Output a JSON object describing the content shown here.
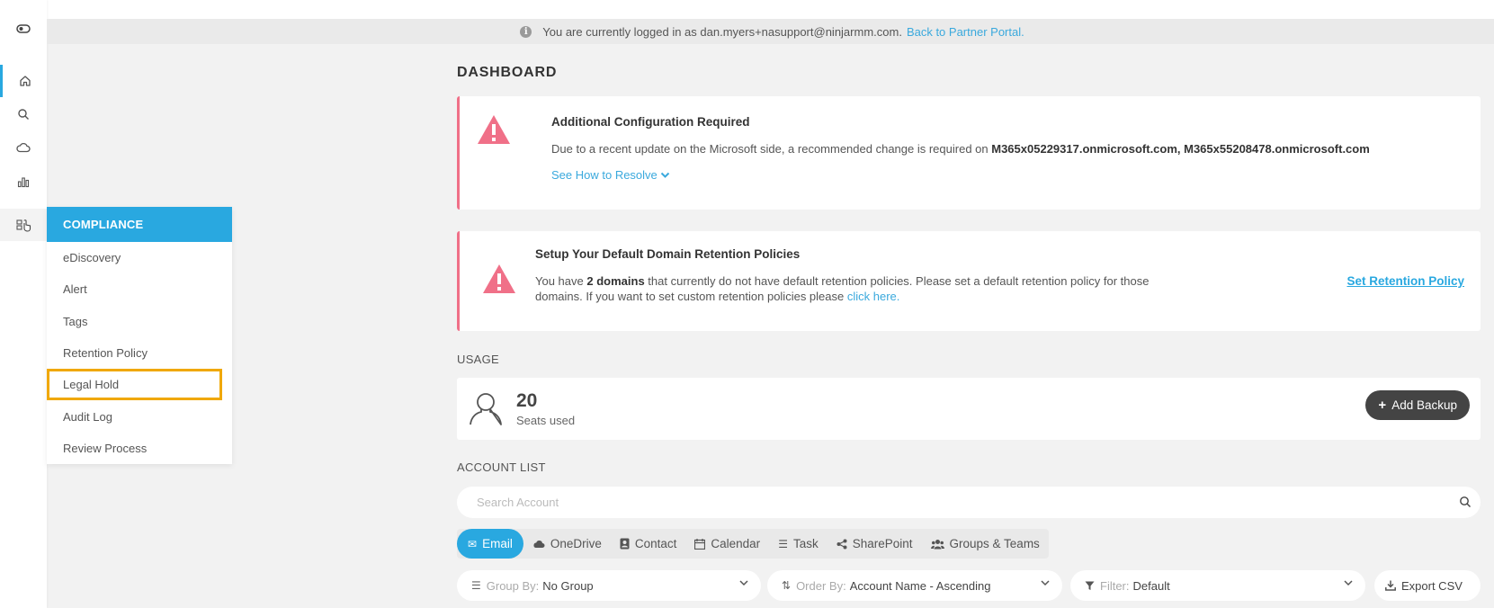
{
  "login_bar": {
    "message": "You are currently logged in as dan.myers+nasupport@ninjarmm.com.",
    "back_link": "Back to Partner Portal."
  },
  "rail": {
    "icons": [
      "toggle-icon",
      "home-icon",
      "search-icon",
      "cloud-icon",
      "chart-icon",
      "compliance-icon"
    ]
  },
  "compliance_menu": {
    "header": "COMPLIANCE",
    "items": [
      "eDiscovery",
      "Alert",
      "Tags",
      "Retention Policy",
      "Legal Hold",
      "Audit Log",
      "Review Process"
    ],
    "highlighted": "Legal Hold"
  },
  "page_title": "DASHBOARD",
  "alert_config": {
    "title": "Additional Configuration Required",
    "text_prefix": "Due to a recent update on the Microsoft side, a recommended change is required on",
    "domains": "M365x05229317.onmicrosoft.com, M365x55208478.onmicrosoft.com",
    "link": "See How to Resolve"
  },
  "alert_retention": {
    "title": "Setup Your Default Domain Retention Policies",
    "text_1": "You have",
    "count": "2 domains",
    "text_2": "that currently do not have default retention policies. Please set a default retention policy for those",
    "text_3": "domains. If you want to set custom retention policies please",
    "link": "click here.",
    "action": "Set Retention Policy"
  },
  "usage": {
    "label": "USAGE",
    "seats": "20",
    "seats_label": "Seats used",
    "add_backup": "Add Backup"
  },
  "account_list": {
    "label": "ACCOUNT LIST",
    "search_placeholder": "Search Account",
    "tabs": [
      "Email",
      "OneDrive",
      "Contact",
      "Calendar",
      "Task",
      "SharePoint",
      "Groups & Teams"
    ],
    "active_tab": "Email",
    "group_by_label": "Group By:",
    "group_by_value": "No Group",
    "order_by_label": "Order By:",
    "order_by_value": "Account Name - Ascending",
    "filter_label": "Filter:",
    "filter_value": "Default",
    "export": "Export CSV"
  },
  "colors": {
    "accent": "#29a8e0",
    "alert_border": "#f07088",
    "highlight_box": "#f0a800"
  }
}
